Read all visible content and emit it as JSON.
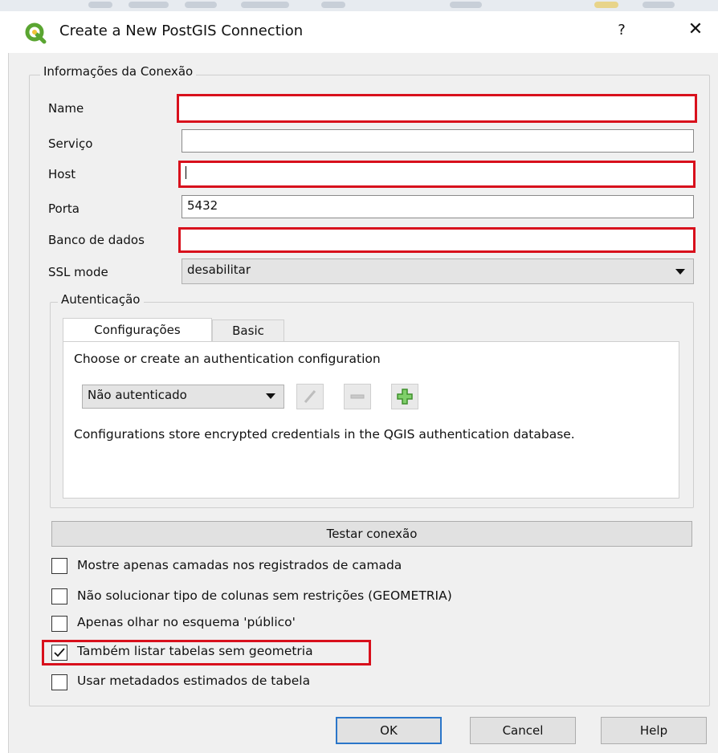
{
  "window": {
    "title": "Create a New PostGIS Connection",
    "help_label": "?",
    "close_label": "✕"
  },
  "connection_info": {
    "legend": "Informações da Conexão",
    "fields": {
      "name": {
        "label": "Name",
        "value": ""
      },
      "service": {
        "label": "Serviço",
        "value": ""
      },
      "host": {
        "label": "Host",
        "value": ""
      },
      "port": {
        "label": "Porta",
        "value": "5432"
      },
      "database": {
        "label": "Banco de dados",
        "value": ""
      },
      "ssl_mode": {
        "label": "SSL mode",
        "value": "desabilitar"
      }
    }
  },
  "authentication": {
    "legend": "Autenticação",
    "tabs": [
      {
        "label": "Configurações",
        "active": true
      },
      {
        "label": "Basic",
        "active": false
      }
    ],
    "prompt": "Choose or create an authentication configuration",
    "config_select": "Não autenticado",
    "icons": [
      "edit-icon",
      "remove-icon",
      "add-icon"
    ],
    "note": "Configurations store encrypted credentials in the QGIS authentication database."
  },
  "test_button": "Testar conexão",
  "options": [
    {
      "label": "Mostre apenas camadas nos registrados de camada",
      "checked": false
    },
    {
      "label": "Não solucionar tipo de colunas sem restrições (GEOMETRIA)",
      "checked": false
    },
    {
      "label": "Apenas olhar no esquema 'público'",
      "checked": false
    },
    {
      "label": "Também listar tabelas sem geometria",
      "checked": true
    },
    {
      "label": "Usar metadados estimados de tabela",
      "checked": false
    }
  ],
  "buttons": {
    "ok": "OK",
    "cancel": "Cancel",
    "help": "Help"
  },
  "colors": {
    "required_highlight": "#d8101c",
    "qgis_green": "#5aa531",
    "default_button_border": "#2b76c9"
  }
}
